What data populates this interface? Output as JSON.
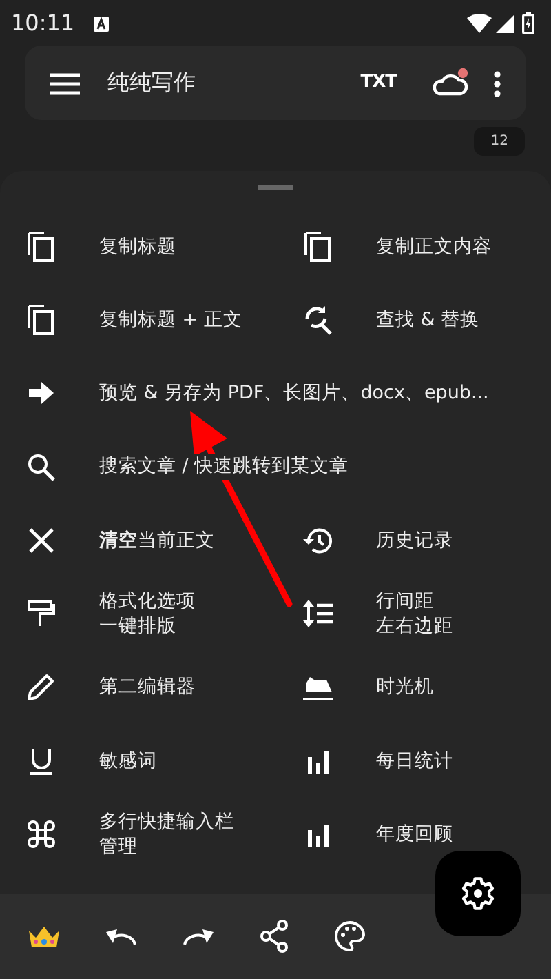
{
  "status_bar": {
    "time": "10:11"
  },
  "toolbar": {
    "title": "纯纯写作",
    "txt_label": "TXT",
    "cloud_notice": true
  },
  "word_count": "12",
  "menu": [
    {
      "kind": "half",
      "label": "复制标题"
    },
    {
      "kind": "half",
      "label": "复制正文内容"
    },
    {
      "kind": "half",
      "label": "复制标题 + 正文"
    },
    {
      "kind": "half",
      "label": "查找 & 替换"
    },
    {
      "kind": "wide",
      "label": "预览 & 另存为 PDF、长图片、docx、epub..."
    },
    {
      "kind": "wide",
      "label": "搜索文章 / 快速跳转到某文章"
    },
    {
      "kind": "half",
      "label": "**清空**当前正文"
    },
    {
      "kind": "half",
      "label": "历史记录"
    },
    {
      "kind": "half",
      "label": "格式化选项",
      "label_2": "一键排版"
    },
    {
      "kind": "half",
      "label": "行间距",
      "label_2": "左右边距"
    },
    {
      "kind": "half",
      "label": "第二编辑器"
    },
    {
      "kind": "half",
      "label": "时光机"
    },
    {
      "kind": "half",
      "label": "敏感词"
    },
    {
      "kind": "half",
      "label": "每日统计"
    },
    {
      "kind": "half",
      "label": "多行快捷输入栏",
      "label_2": "管理"
    },
    {
      "kind": "half",
      "label": "年度回顾"
    }
  ]
}
